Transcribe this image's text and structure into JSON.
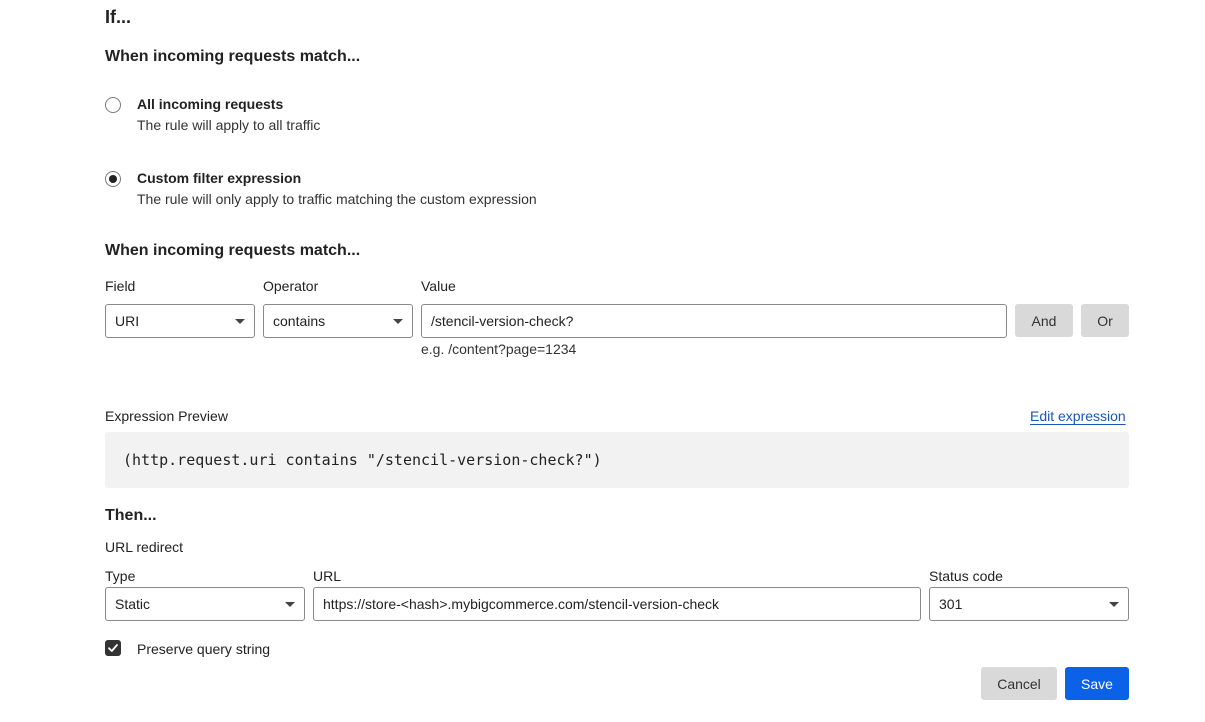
{
  "if_heading": "If...",
  "match_heading_1": "When incoming requests match...",
  "options": [
    {
      "title": "All incoming requests",
      "description": "The rule will apply to all traffic",
      "selected": false
    },
    {
      "title": "Custom filter expression",
      "description": "The rule will only apply to traffic matching the custom expression",
      "selected": true
    }
  ],
  "match_heading_2": "When incoming requests match...",
  "filter": {
    "field_label": "Field",
    "field_value": "URI",
    "operator_label": "Operator",
    "operator_value": "contains",
    "value_label": "Value",
    "value_value": "/stencil-version-check?",
    "value_hint": "e.g. /content?page=1234",
    "and_label": "And",
    "or_label": "Or"
  },
  "preview": {
    "label": "Expression Preview",
    "edit_link": "Edit expression",
    "expression": "(http.request.uri contains \"/stencil-version-check?\")"
  },
  "then": {
    "heading": "Then...",
    "action": "URL redirect",
    "type_label": "Type",
    "type_value": "Static",
    "url_label": "URL",
    "url_value": "https://store-<hash>.mybigcommerce.com/stencil-version-check",
    "status_label": "Status code",
    "status_value": "301",
    "preserve_label": "Preserve query string",
    "preserve_checked": true
  },
  "actions": {
    "cancel": "Cancel",
    "save": "Save"
  },
  "colors": {
    "primary": "#0b62e6",
    "link": "#1a56b8",
    "secondary_button": "#d9d9d9",
    "preview_bg": "#f2f2f2"
  }
}
